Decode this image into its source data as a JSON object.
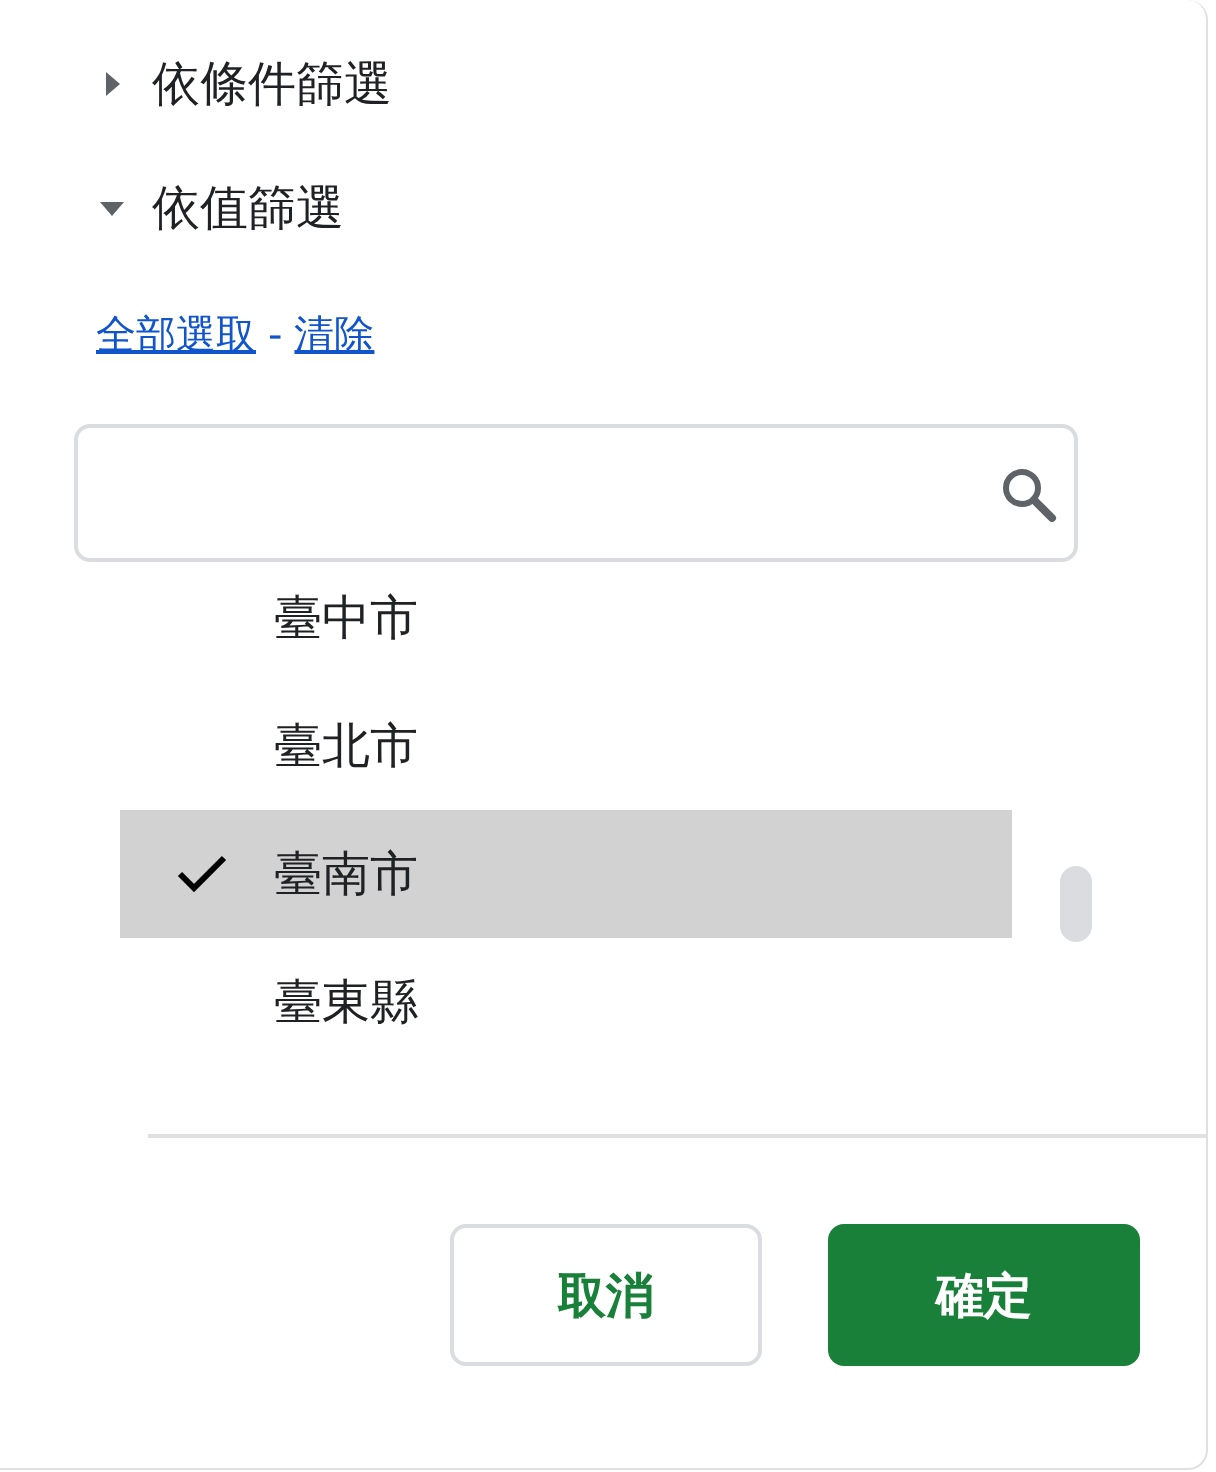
{
  "sections": [
    {
      "label": "依條件篩選",
      "expanded": false
    },
    {
      "label": "依值篩選",
      "expanded": true
    }
  ],
  "links": {
    "select_all": "全部選取",
    "separator": "-",
    "clear": "清除"
  },
  "values": [
    {
      "label": "臺中市",
      "selected": false
    },
    {
      "label": "臺北市",
      "selected": false
    },
    {
      "label": "臺南市",
      "selected": true
    },
    {
      "label": "臺東縣",
      "selected": false
    }
  ],
  "buttons": {
    "cancel": "取消",
    "ok": "確定"
  }
}
